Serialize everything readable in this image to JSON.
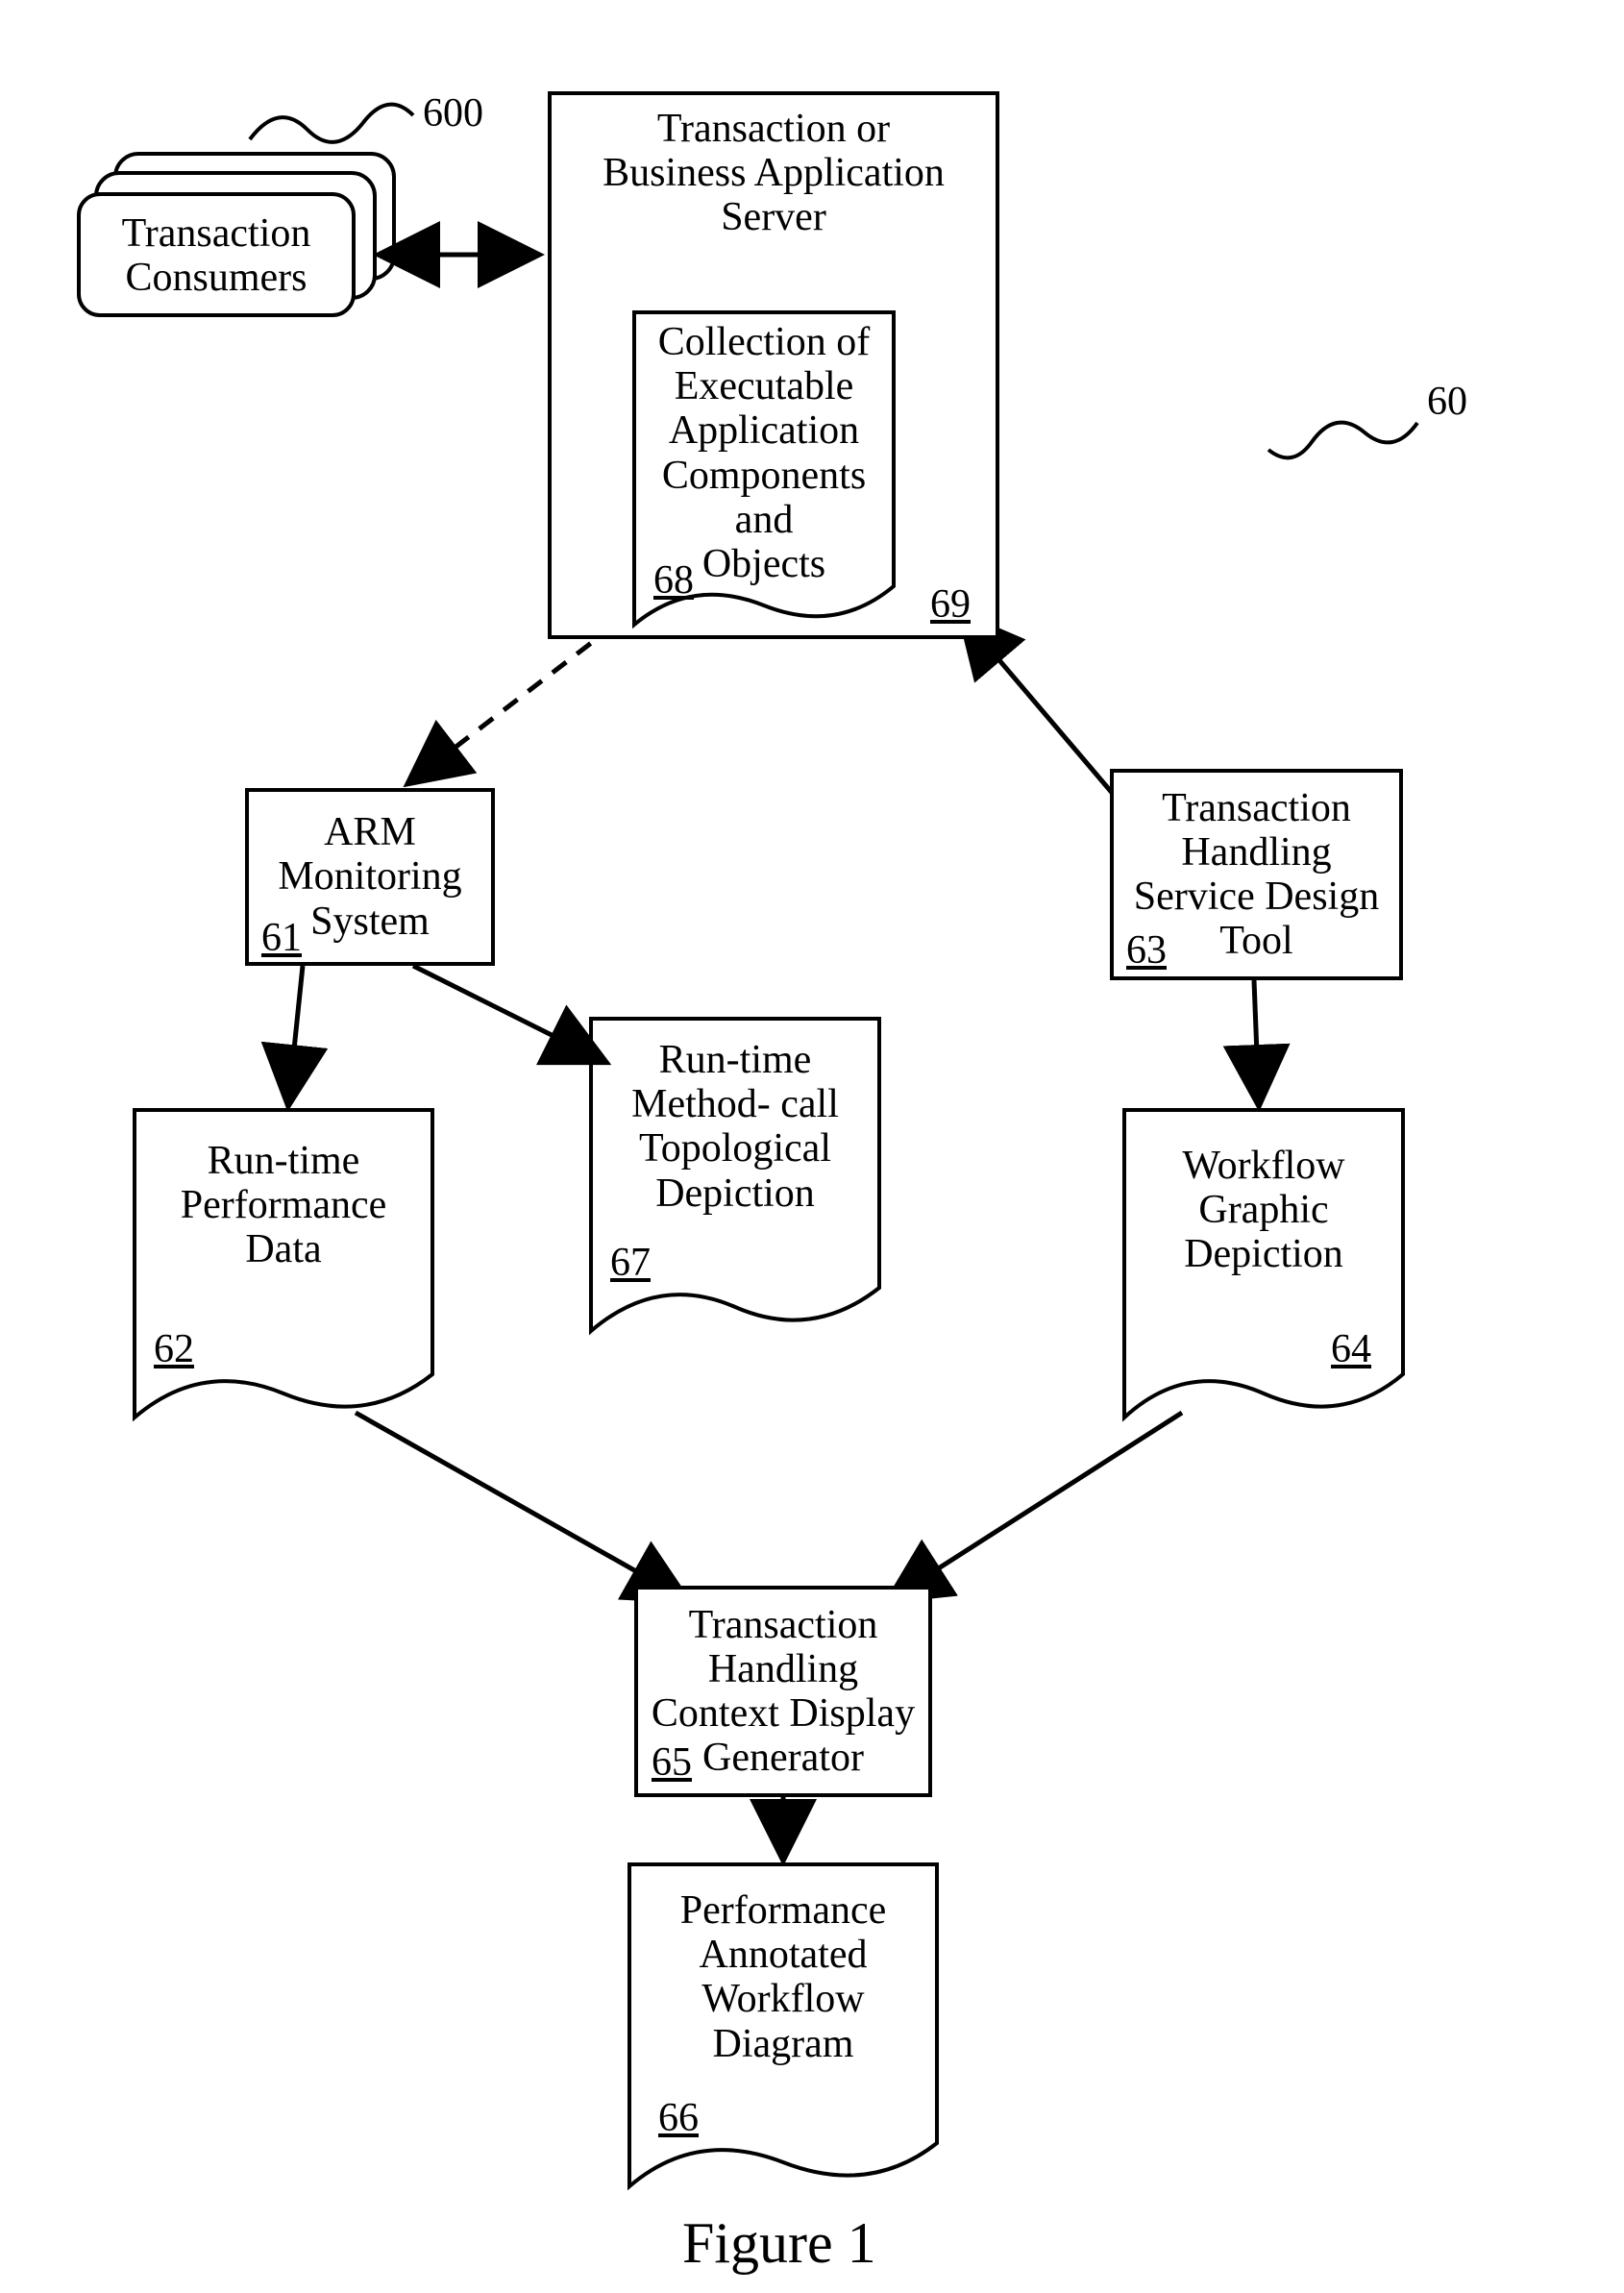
{
  "figure_label": "Figure 1",
  "nodes": {
    "consumers": {
      "label": "Transaction\nConsumers",
      "ref": "600"
    },
    "server": {
      "label": "Transaction or\nBusiness Application\nServer",
      "ref": "69"
    },
    "collection": {
      "label": "Collection of\nExecutable\nApplication\nComponents and\nObjects",
      "ref": "68"
    },
    "arm": {
      "label": "ARM\nMonitoring\nSystem",
      "ref": "61"
    },
    "designtool": {
      "label": "Transaction\nHandling\nService Design\nTool",
      "ref": "63"
    },
    "perfdata": {
      "label": "Run-time\nPerformance\nData",
      "ref": "62"
    },
    "topology": {
      "label": "Run-time\nMethod- call\nTopological\nDepiction",
      "ref": "67"
    },
    "workflow": {
      "label": "Workflow\nGraphic\nDepiction",
      "ref": "64"
    },
    "generator": {
      "label": "Transaction\nHandling\nContext Display\nGenerator",
      "ref": "65"
    },
    "annotated": {
      "label": "Performance\nAnnotated\nWorkflow\nDiagram",
      "ref": "66"
    }
  },
  "diagram_ref": "60"
}
